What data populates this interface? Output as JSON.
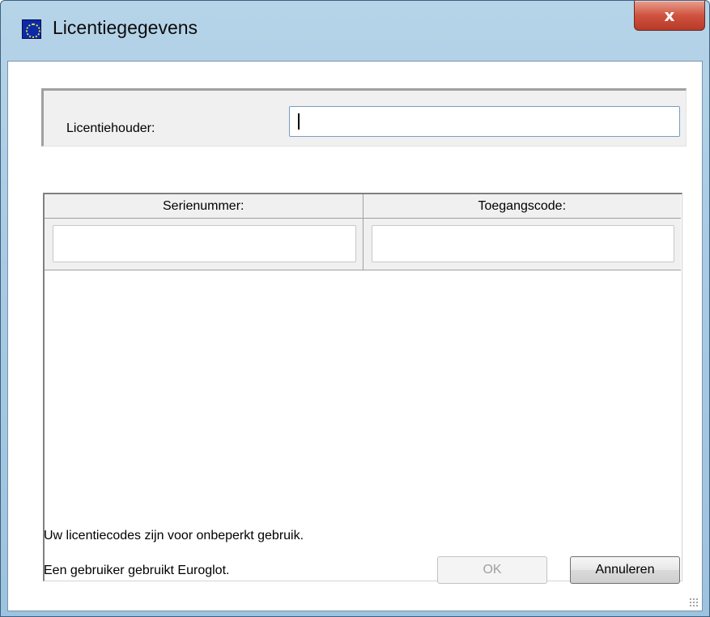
{
  "window": {
    "title": "Licentiegegevens",
    "close_label": "x"
  },
  "holder": {
    "label": "Licentiehouder:",
    "value": ""
  },
  "grid": {
    "columns": [
      "Serienummer:",
      "Toegangscode:"
    ],
    "rows": [
      {
        "serial": "",
        "access_code": ""
      }
    ]
  },
  "info": {
    "line1": "Uw licentiecodes zijn voor onbeperkt gebruik.",
    "line2": "Een gebruiker gebruikt Euroglot."
  },
  "buttons": {
    "ok_label": "OK",
    "ok_enabled": false,
    "cancel_label": "Annuleren"
  },
  "colors": {
    "title_bar": "#a9cbe3",
    "close_button": "#c7472f",
    "app_icon": "#0b2aa8"
  },
  "icons": {
    "app": "euroglot-app-icon",
    "close": "close-icon",
    "grip": "resize-grip-icon"
  }
}
